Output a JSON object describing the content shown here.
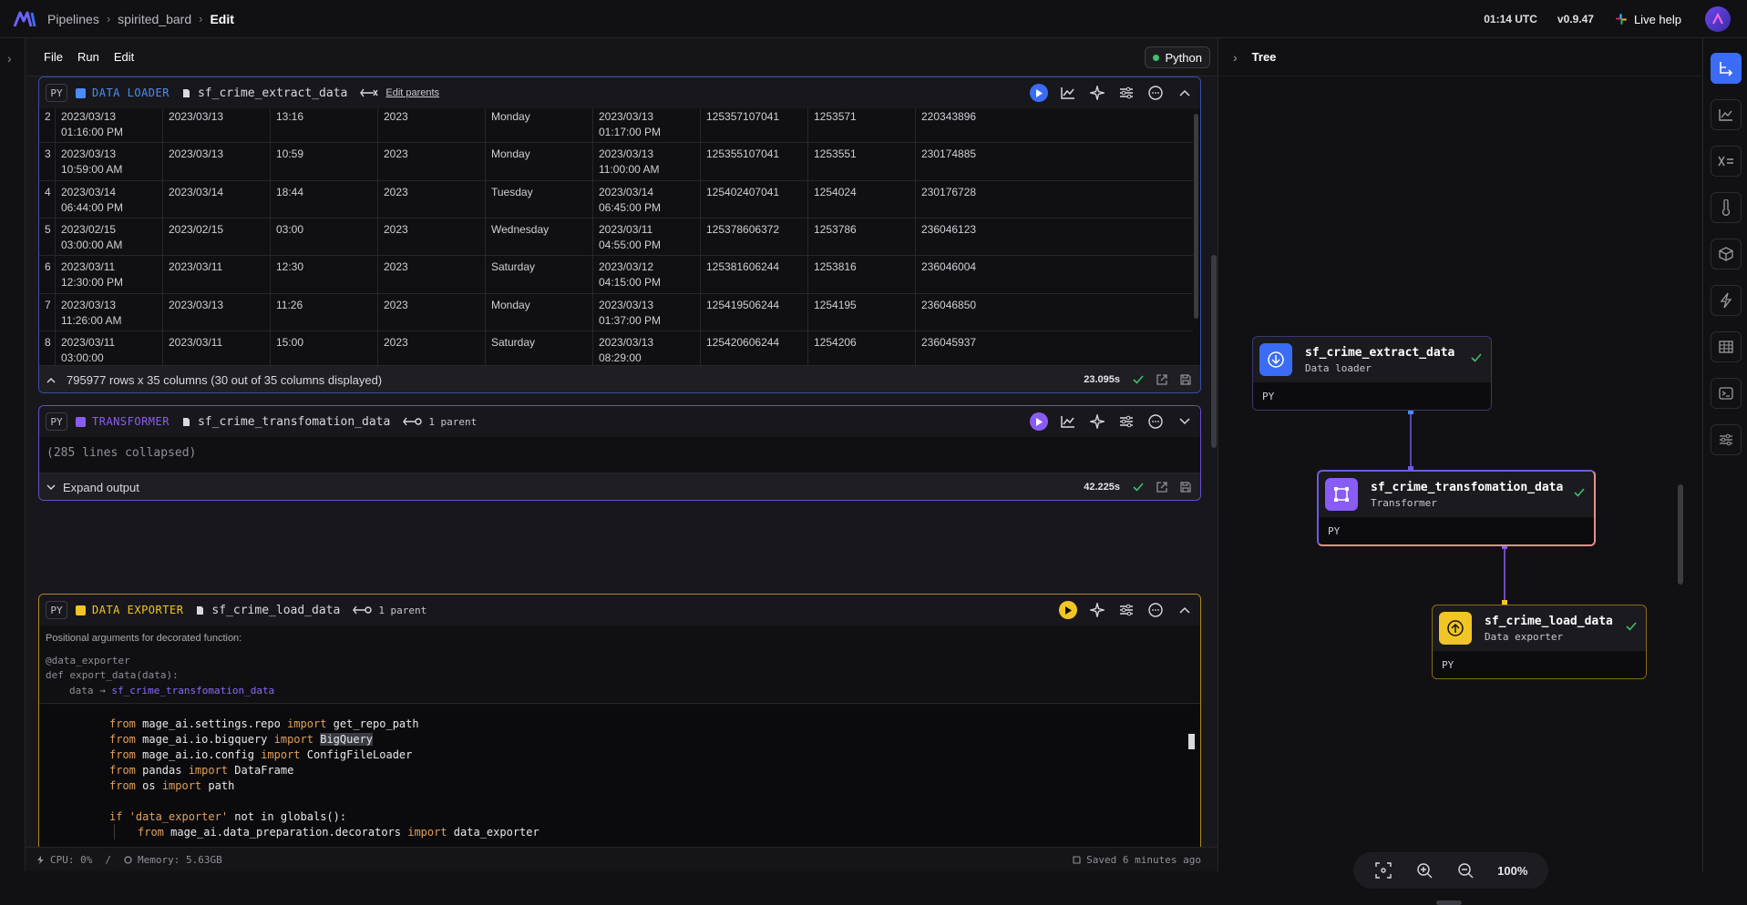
{
  "header": {
    "breadcrumbs": [
      "Pipelines",
      "spirited_bard",
      "Edit"
    ],
    "clock": "01:14 UTC",
    "version": "v0.9.47",
    "live_help": "Live help"
  },
  "menu": {
    "items": [
      "File",
      "Run",
      "Edit"
    ],
    "kernel": "Python"
  },
  "blocks": [
    {
      "tag": "PY",
      "type_label": "DATA LOADER",
      "color": "#4a8cf7",
      "name": "sf_crime_extract_data",
      "parents": "Edit parents",
      "rows": [
        [
          "2",
          "2023/03/13 01:16:00 PM",
          "2023/03/13",
          "13:16",
          "2023",
          "Monday",
          "2023/03/13 01:17:00 PM",
          "125357107041",
          "1253571",
          "220343896"
        ],
        [
          "3",
          "2023/03/13 10:59:00 AM",
          "2023/03/13",
          "10:59",
          "2023",
          "Monday",
          "2023/03/13 11:00:00 AM",
          "125355107041",
          "1253551",
          "230174885"
        ],
        [
          "4",
          "2023/03/14 06:44:00 PM",
          "2023/03/14",
          "18:44",
          "2023",
          "Tuesday",
          "2023/03/14 06:45:00 PM",
          "125402407041",
          "1254024",
          "230176728"
        ],
        [
          "5",
          "2023/02/15 03:00:00 AM",
          "2023/02/15",
          "03:00",
          "2023",
          "Wednesday",
          "2023/03/11 04:55:00 PM",
          "125378606372",
          "1253786",
          "236046123"
        ],
        [
          "6",
          "2023/03/11 12:30:00 PM",
          "2023/03/11",
          "12:30",
          "2023",
          "Saturday",
          "2023/03/12 04:15:00 PM",
          "125381606244",
          "1253816",
          "236046004"
        ],
        [
          "7",
          "2023/03/13 11:26:00 AM",
          "2023/03/13",
          "11:26",
          "2023",
          "Monday",
          "2023/03/13 01:37:00 PM",
          "125419506244",
          "1254195",
          "236046850"
        ],
        [
          "8",
          "2023/03/11 03:00:00",
          "2023/03/11",
          "15:00",
          "2023",
          "Saturday",
          "2023/03/13 08:29:00",
          "125420606244",
          "1254206",
          "236045937"
        ]
      ],
      "footer_text": "795977 rows x 35 columns (30 out of 35 columns displayed)",
      "footer_time": "23.095s"
    },
    {
      "tag": "PY",
      "type_label": "TRANSFORMER",
      "color": "#8a5cf6",
      "name": "sf_crime_transfomation_data",
      "parents": "1 parent",
      "collapsed": "(285 lines collapsed)",
      "footer_text": "Expand output",
      "footer_time": "42.225s"
    },
    {
      "tag": "PY",
      "type_label": "DATA EXPORTER",
      "color": "#f2c526",
      "name": "sf_crime_load_data",
      "parents": "1 parent",
      "args_title": "Positional arguments for decorated function:",
      "decorator": "@data_exporter",
      "def_line": "def export_data(data):",
      "arg_name": "data",
      "arg_source": "sf_crime_transfomation_data",
      "code": [
        {
          "kw1": "from",
          "mod": "mage_ai.settings.repo",
          "kw2": "import",
          "obj": "get_repo_path"
        },
        {
          "kw1": "from",
          "mod": "mage_ai.io.bigquery",
          "kw2": "import",
          "obj": "BigQuery"
        },
        {
          "kw1": "from",
          "mod": "mage_ai.io.config",
          "kw2": "import",
          "obj": "ConfigFileLoader"
        },
        {
          "kw1": "from",
          "mod": "pandas",
          "kw2": "import",
          "obj": "DataFrame"
        },
        {
          "kw1": "from",
          "mod": "os",
          "kw2": "import",
          "obj": "path"
        }
      ],
      "if_line": {
        "kw": "if",
        "str": "'data_exporter'",
        "rest": "not in globals():"
      },
      "inner_line": {
        "kw1": "from",
        "mod": "mage_ai.data_preparation.decorators",
        "kw2": "import",
        "obj": "data_exporter"
      }
    }
  ],
  "status": {
    "cpu": "CPU: 0%",
    "sep": "/",
    "memory": "Memory: 5.63GB",
    "saved": "Saved 6 minutes ago"
  },
  "tree": {
    "title": "Tree",
    "nodes": [
      {
        "title": "sf_crime_extract_data",
        "subtitle": "Data loader",
        "lang": "PY",
        "color": "#4a8cf7"
      },
      {
        "title": "sf_crime_transfomation_data",
        "subtitle": "Transformer",
        "lang": "PY",
        "color": "#8a5cf6"
      },
      {
        "title": "sf_crime_load_data",
        "subtitle": "Data exporter",
        "lang": "PY",
        "color": "#f2c526"
      }
    ],
    "zoom": "100%"
  }
}
